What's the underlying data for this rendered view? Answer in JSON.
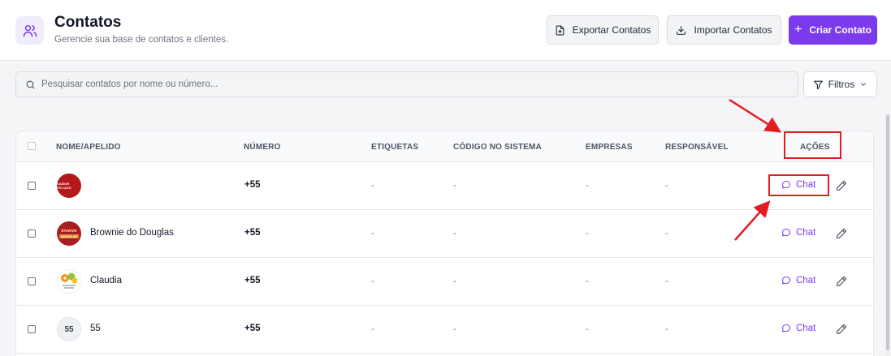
{
  "header": {
    "title": "Contatos",
    "subtitle": "Gerencie sua base de contatos e clientes.",
    "icon": "users-icon",
    "export_label": "Exportar Contatos",
    "import_label": "Importar Contatos",
    "create_label": "Criar Contato",
    "accent_color": "#7c3aed"
  },
  "search": {
    "placeholder": "Pesquisar contatos por nome ou número...",
    "value": ""
  },
  "filters": {
    "label": "Filtros"
  },
  "table": {
    "columns": [
      "NOME/APELIDO",
      "NÚMERO",
      "ETIQUETAS",
      "CÓDIGO NO SISTEMA",
      "EMPRESAS",
      "RESPONSÁVEL",
      "AÇÕES"
    ],
    "rows": [
      {
        "avatar": "red-logo",
        "avatar_text": "SABOR PELUDO",
        "name": "",
        "number": "+55",
        "tags": "-",
        "code": "-",
        "companies": "-",
        "responsible": "-",
        "chat_label": "Chat"
      },
      {
        "avatar": "brownie-logo",
        "avatar_text": "brownie",
        "avatar_sub": "DOUGLAS",
        "name": "Brownie do Douglas",
        "number": "+55",
        "tags": "-",
        "code": "-",
        "companies": "-",
        "responsible": "-",
        "chat_label": "Chat"
      },
      {
        "avatar": "flower-logo",
        "name": "Claudia",
        "number": "+55",
        "tags": "-",
        "code": "-",
        "companies": "-",
        "responsible": "-",
        "chat_label": "Chat"
      },
      {
        "avatar": "initials",
        "initials": "55",
        "name": "55",
        "number": "+55",
        "tags": "-",
        "code": "-",
        "companies": "-",
        "responsible": "-",
        "chat_label": "Chat"
      }
    ]
  },
  "annotations": {
    "highlight_color": "#e11d24"
  }
}
